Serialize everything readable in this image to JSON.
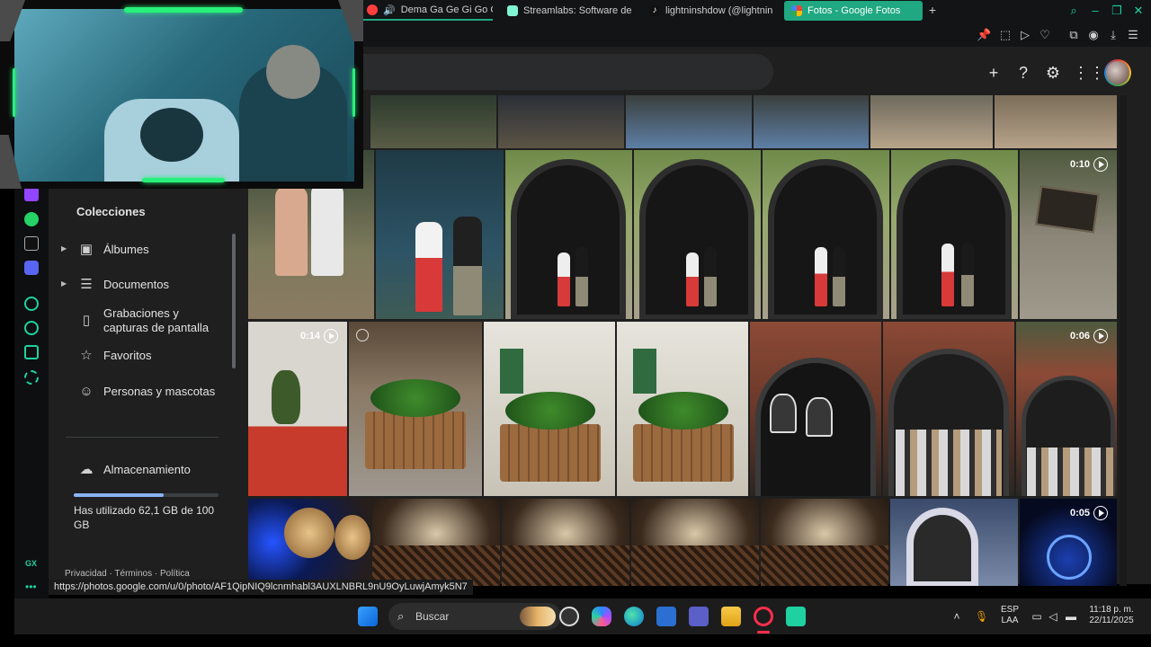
{
  "browser": {
    "tabs": [
      {
        "title": "Dema Ga Ge Gi Go Gu",
        "state": "audio-playing",
        "color": "#ff3d3d"
      },
      {
        "title": "Streamlabs: Software de",
        "state": "normal",
        "color": "#80f5d2"
      },
      {
        "title": "lightninshdow (@lightnin",
        "state": "normal",
        "color": "#ffffff"
      },
      {
        "title": "Fotos - Google Fotos",
        "state": "active",
        "color": "#fbbc04"
      }
    ],
    "accent_color": "#1fa882"
  },
  "photos": {
    "sidebar": {
      "heading": "Colecciones",
      "items": [
        {
          "label": "Álbumes",
          "icon": "album-icon",
          "expandable": true
        },
        {
          "label": "Documentos",
          "icon": "document-icon",
          "expandable": true
        },
        {
          "label": "Grabaciones y capturas de pantalla",
          "icon": "phone-screenshot-icon",
          "expandable": false
        },
        {
          "label": "Favoritos",
          "icon": "star-icon",
          "expandable": false
        },
        {
          "label": "Personas y mascotas",
          "icon": "face-icon",
          "expandable": false
        }
      ],
      "storage": {
        "label": "Almacenamiento",
        "usage_text": "Has utilizado 62,1 GB de 100 GB",
        "used_fraction": 0.621
      },
      "footer": {
        "privacy": "Privacidad",
        "terms": "Términos",
        "policy": "Política"
      }
    },
    "videos": {
      "v1": "0:10",
      "v2": "0:14",
      "v3": "0:06",
      "v4": "0:05"
    }
  },
  "status_url": "https://photos.google.com/u/0/photo/AF1QipNIQ9lcnmhabl3AUXLNBRL9nU9OyLuwjAmyk5N7",
  "taskbar": {
    "search_label": "Buscar",
    "language": "ESP",
    "region": "LAA",
    "time": "11:18 p. m.",
    "date": "22/11/2025"
  },
  "opera_gx": {
    "label": "GX"
  }
}
